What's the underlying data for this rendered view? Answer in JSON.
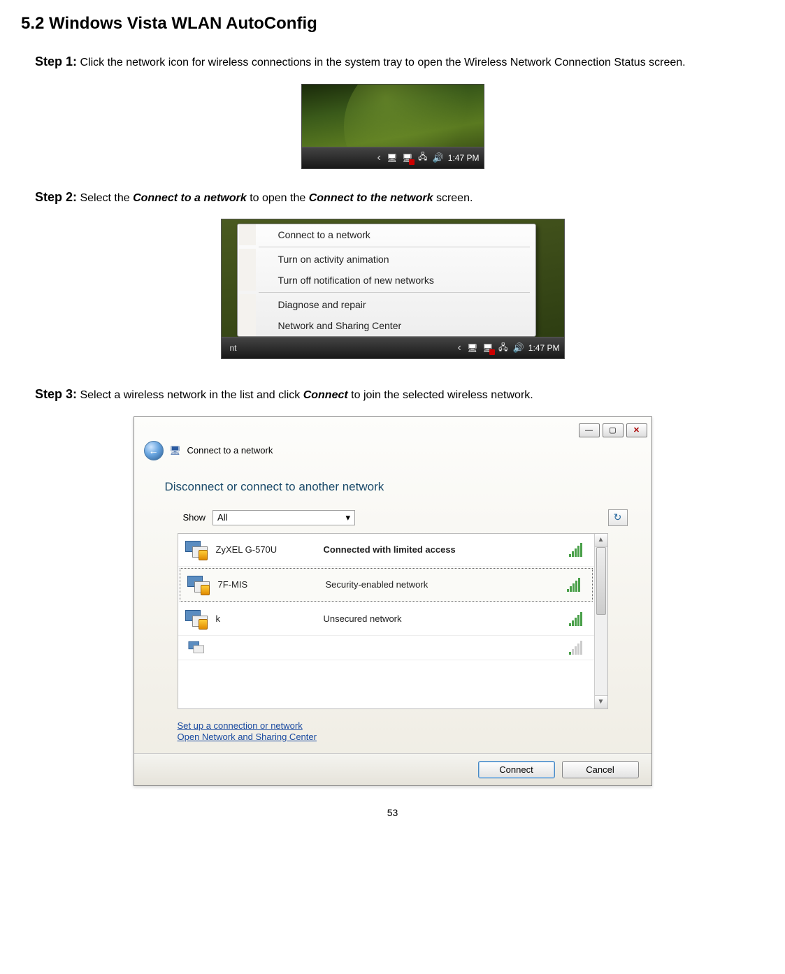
{
  "heading": "5.2 Windows Vista WLAN AutoConfig",
  "step1": {
    "label": "Step 1:",
    "text_a": " Click the network icon for wireless connections in the system tray to open the Wireless Network Connection Status screen."
  },
  "systray": {
    "time": "1:47 PM",
    "chev": "‹"
  },
  "step2": {
    "label": "Step 2:",
    "text_a": " Select the ",
    "em1": "Connect to a network",
    "text_b": " to open the ",
    "em2": "Connect to the network",
    "text_c": " screen."
  },
  "ctxmenu": {
    "i1": "Connect to a network",
    "i2": "Turn on activity animation",
    "i3": "Turn off notification of new networks",
    "i4": "Diagnose and repair",
    "i5": "Network and Sharing Center",
    "tb_left": "nt",
    "time": "1:47 PM",
    "chev": "‹"
  },
  "step3": {
    "label": "Step 3:",
    "text_a": " Select a wireless network in the list and click ",
    "em1": "Connect",
    "text_b": " to join the selected wireless network."
  },
  "dialog": {
    "crumb": "Connect to a network",
    "title": "Disconnect or connect to another network",
    "show_label": "Show",
    "show_value": "All",
    "net1": {
      "name": "ZyXEL G-570U",
      "status": "Connected with limited access"
    },
    "net2": {
      "name": "7F-MIS",
      "status": "Security-enabled network"
    },
    "net3": {
      "name": "k",
      "status": "Unsecured network"
    },
    "link1": "Set up a connection or network",
    "link2": "Open Network and Sharing Center",
    "btn_connect": "Connect",
    "btn_cancel": "Cancel"
  },
  "page_num": "53"
}
